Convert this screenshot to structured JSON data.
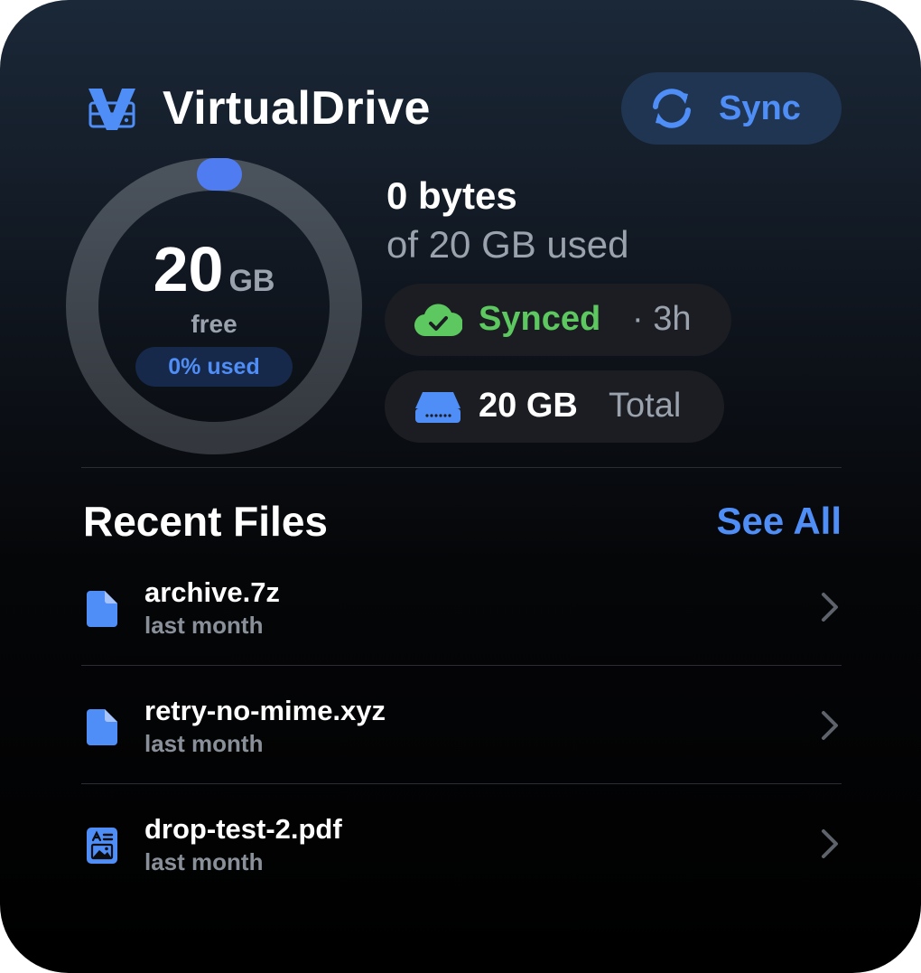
{
  "header": {
    "logo_icon": "virtual-drive-logo-icon",
    "title": "VirtualDrive",
    "sync_button": {
      "label": "Sync",
      "icon": "sync-arrows-icon"
    }
  },
  "storage": {
    "free_value": "20",
    "free_unit": "GB",
    "free_label": "free",
    "used_percent_label": "0% used",
    "used_fraction": 0,
    "used_amount": "0 bytes",
    "used_of_total": "of 20 GB used",
    "sync_status": {
      "icon": "cloud-check-icon",
      "label": "Synced",
      "time": "· 3h",
      "color": "#5cc85f"
    },
    "total": {
      "icon": "hard-drive-icon",
      "value": "20 GB",
      "label": "Total"
    }
  },
  "recent_files": {
    "title": "Recent Files",
    "see_all": "See All",
    "items": [
      {
        "name": "archive.7z",
        "date": "last month",
        "icon": "document-icon"
      },
      {
        "name": "retry-no-mime.xyz",
        "date": "last month",
        "icon": "document-icon"
      },
      {
        "name": "drop-test-2.pdf",
        "date": "last month",
        "icon": "pdf-document-icon"
      }
    ]
  },
  "colors": {
    "accent": "#4f8ef7",
    "success": "#5cc85f",
    "ring_track": "#3a3f46"
  }
}
